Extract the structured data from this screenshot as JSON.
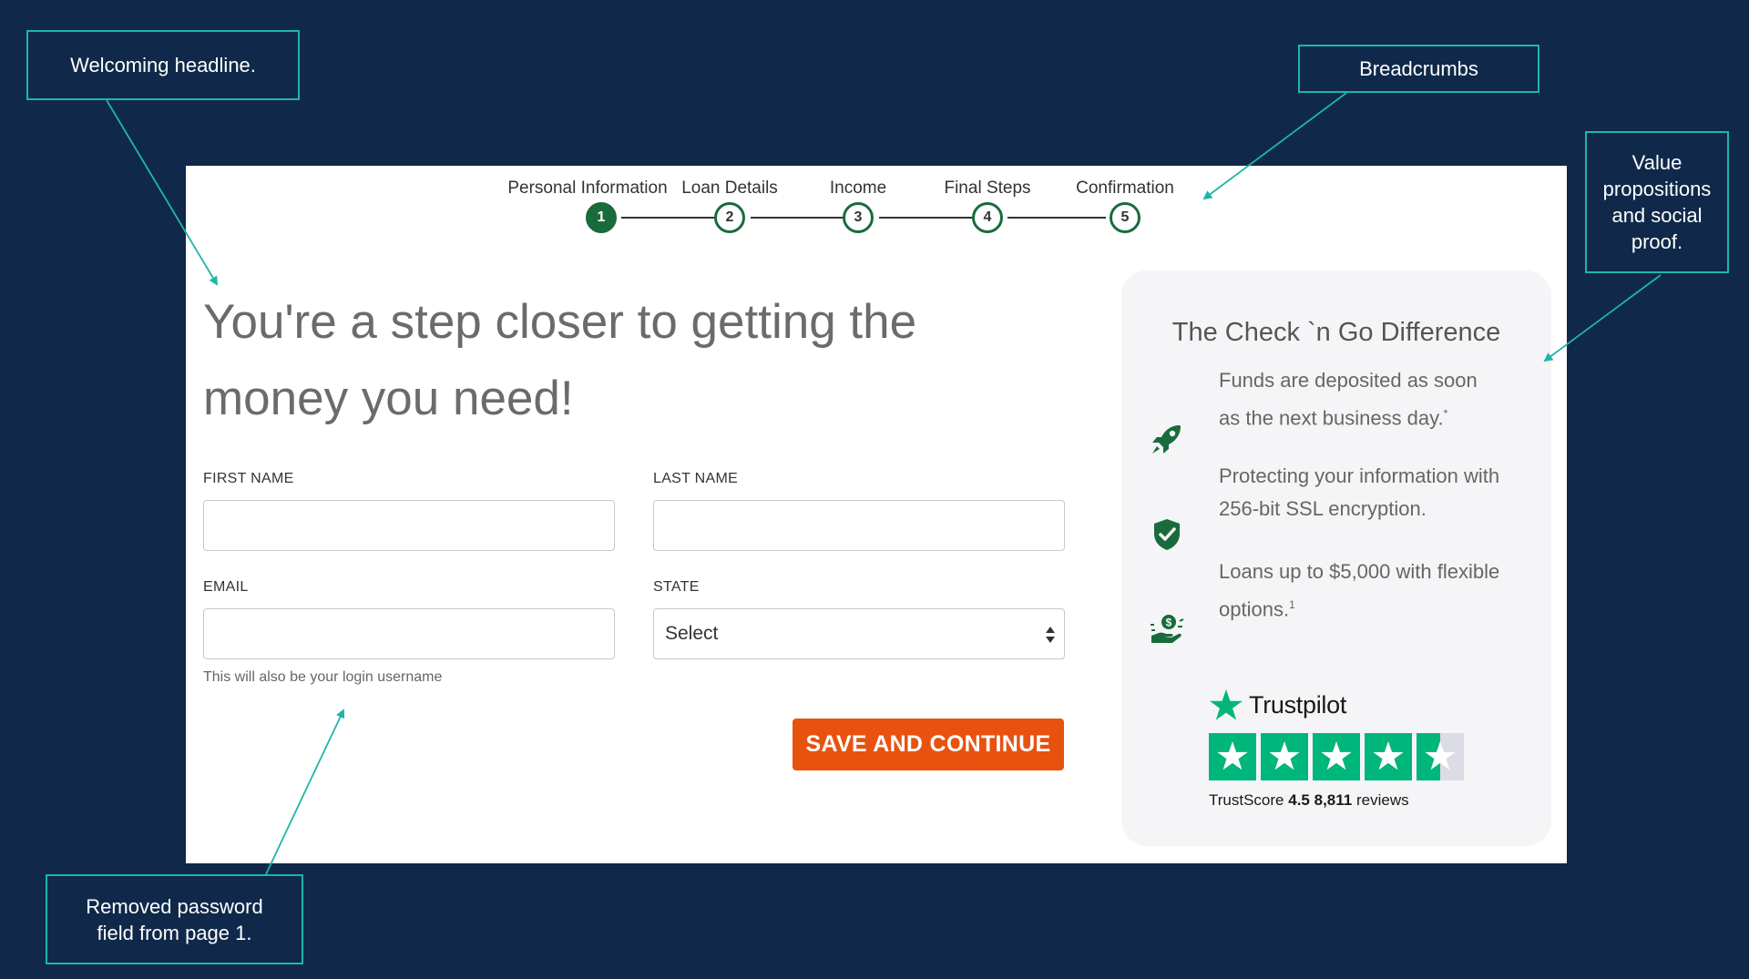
{
  "annotations": {
    "headline": "Welcoming headline.",
    "breadcrumbs": "Breadcrumbs",
    "value": "Value\npropositions\nand social\nproof.",
    "password": "Removed password\nfield from page 1."
  },
  "stepper": [
    {
      "number": "1",
      "label": "Personal Information"
    },
    {
      "number": "2",
      "label": "Loan Details"
    },
    {
      "number": "3",
      "label": "Income"
    },
    {
      "number": "4",
      "label": "Final Steps"
    },
    {
      "number": "5",
      "label": "Confirmation"
    }
  ],
  "stepper_active": "1",
  "headline": "You're a step closer to getting the money you need!",
  "form": {
    "first_name_label": "FIRST NAME",
    "last_name_label": "LAST NAME",
    "email_label": "EMAIL",
    "state_label": "STATE",
    "state_value": "Select",
    "email_hint": "This will also be your login username",
    "submit_label": "SAVE AND CONTINUE"
  },
  "card": {
    "title": "The Check `n Go Difference",
    "items": [
      {
        "icon": "rocket-icon",
        "text": "Funds are deposited as soon as the next business day.",
        "sup": "*"
      },
      {
        "icon": "shield-check-icon",
        "text": "Protecting your information with 256-bit SSL encryption.",
        "sup": ""
      },
      {
        "icon": "money-hand-icon",
        "text": "Loans up to $5,000 with flexible options.",
        "sup": "1"
      }
    ],
    "trustpilot": {
      "name": "Trustpilot",
      "score_label": "TrustScore",
      "score": "4.5",
      "reviews_count": "8,811",
      "reviews_label": "reviews",
      "stars_value": 4.5
    }
  },
  "colors": {
    "background": "#10294a",
    "accent_green": "#1a6b3c",
    "button": "#e8520f",
    "trustpilot_green": "#00b67a",
    "callout_border": "#1fb5a8"
  }
}
